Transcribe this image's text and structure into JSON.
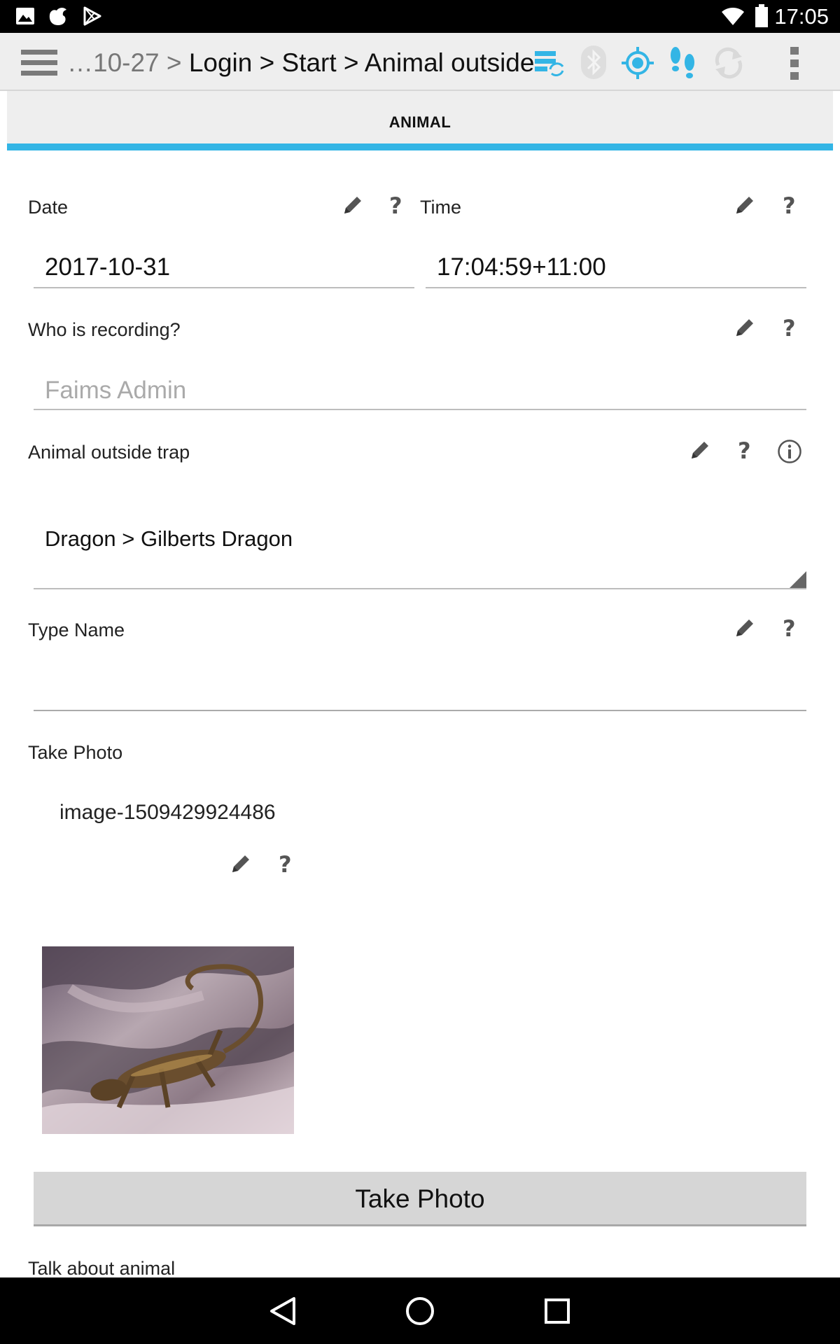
{
  "status_bar": {
    "time": "17:05",
    "left_icons": [
      "gallery-icon",
      "app-icon",
      "play-store-icon"
    ],
    "right_icons": [
      "wifi-icon",
      "battery-icon"
    ]
  },
  "action_bar": {
    "breadcrumb_prefix": "…10-27 >",
    "breadcrumb_path": "Login > Start > Animal outside",
    "icons": [
      "menu-icon",
      "sync-icon",
      "bluetooth-icon",
      "gps-icon",
      "tracking-icon",
      "refresh-icon",
      "overflow-menu-icon"
    ],
    "accent_color": "#33b5e5"
  },
  "tab": {
    "label": "ANIMAL",
    "indicator_color": "#33b5e5"
  },
  "form": {
    "date": {
      "label": "Date",
      "value": "2017-10-31"
    },
    "time": {
      "label": "Time",
      "value": "17:04:59+11:00"
    },
    "recorder": {
      "label": "Who is recording?",
      "placeholder": "Faims Admin"
    },
    "animal": {
      "label": "Animal outside trap",
      "value": "Dragon > Gilberts Dragon"
    },
    "type_name": {
      "label": "Type Name",
      "value": ""
    },
    "photo": {
      "label": "Take Photo",
      "filename": "image-1509429924486",
      "button_label": "Take Photo"
    },
    "talk": {
      "label": "Talk about animal"
    }
  },
  "nav_bar": {
    "icons": [
      "back-icon",
      "home-icon",
      "recents-icon"
    ]
  }
}
